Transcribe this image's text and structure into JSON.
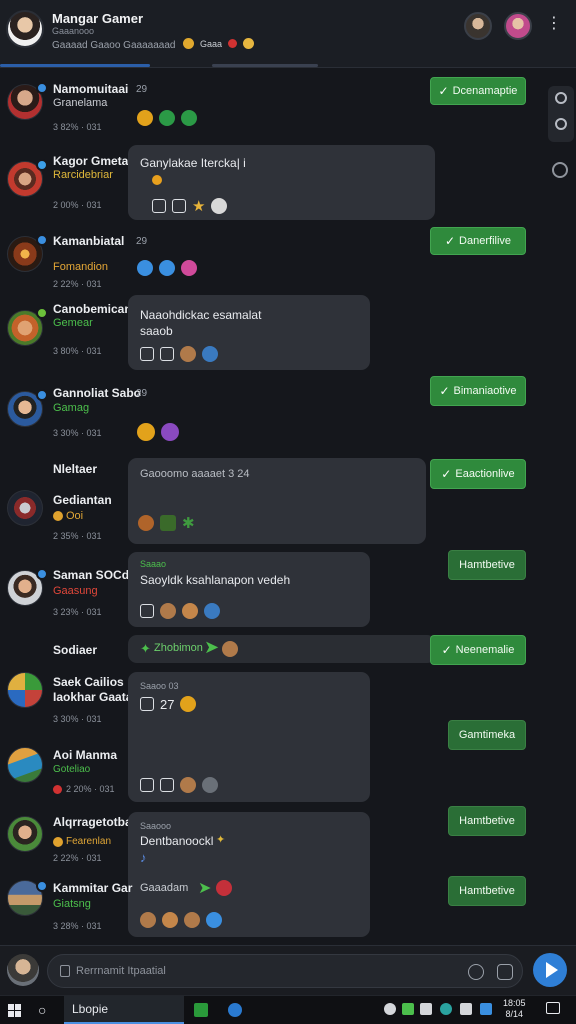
{
  "header": {
    "title": "Mangar Gamer",
    "subtitle": "Gaaanooo",
    "status_line": "Gaaaad Gaaoo Gaaaaaaad",
    "status_badge": "Gaaa"
  },
  "messages": [
    {
      "name": "Namomuitaai",
      "subtitle": "Granelama",
      "meta": "3 82% · 031",
      "count": "29",
      "status": "Dcenamaptie"
    },
    {
      "name": "Kagor Gmetae",
      "subtitle": "Rarcidebriar",
      "meta": "2 00% · 031",
      "bubble_text": "Ganylakae Itercka| i"
    },
    {
      "name": "Kamanbiatal",
      "subtitle": "Fomandion",
      "meta": "2 22% · 031",
      "count": "29",
      "status": "Danerfilive"
    },
    {
      "name": "Canobemican",
      "subtitle": "Gemear",
      "meta": "3 80% · 031",
      "bubble_text": "Naaohdickac esamalat",
      "bubble_text2": "saaob"
    },
    {
      "name": "Gannoliat Sabo",
      "subtitle": "Gamag",
      "meta": "3 30% · 031",
      "count": "29",
      "status": "Bimaniaotive"
    },
    {
      "name": "Nleltaer",
      "subtitle": "",
      "meta": "",
      "bubble_text": "Gaooomo aaaaet 3 24",
      "status": "Eaactionlive"
    },
    {
      "name": "Gediantan",
      "subtitle": "Ooi",
      "meta": "2 35% · 031",
      "bubble_text": ""
    },
    {
      "name": "Saman SOCdo",
      "subtitle": "Gaasung",
      "meta": "3 23% · 031",
      "bubble_tag": "Saaao",
      "bubble_text": "Saoyldk ksahlanapon vedeh",
      "status": "Hamtbetive"
    },
    {
      "name": "Sodiaer",
      "subtitle": "",
      "meta": "",
      "bubble_text": "Zhobimon",
      "status": "Neenemalie"
    },
    {
      "name": "Saek Cailios",
      "subtitle": "Iaokhar Gaata",
      "meta": "3 30% · 031",
      "bubble_text": "Saaoo 03",
      "bubble_text2": "27"
    },
    {
      "name": "Aoi Manma",
      "subtitle": "Goteliao",
      "meta": "2 20% · 031",
      "status": "Gamtimeka"
    },
    {
      "name": "Alqrragetotbake",
      "subtitle": "Fearenlan",
      "meta": "2 22% · 031",
      "bubble_tag": "Saaooo",
      "bubble_text": "Dentbanoockl",
      "status": "Hamtbetive"
    },
    {
      "name": "Kammitar Gar",
      "subtitle": "Giatsng",
      "meta": "3 28% · 031",
      "bubble_text": "Gaaadam",
      "status": "Hamtbetive"
    }
  ],
  "composer": {
    "placeholder": "Rerrnamit Itpaatial"
  },
  "taskbar": {
    "search": "Lbopie",
    "clock_time": "18:05",
    "clock_date": "8/14"
  },
  "colors": {
    "accent": "#2f7fd6",
    "status_green": "#2f8a3c",
    "bubble": "#2f3239",
    "background": "#15171c"
  }
}
